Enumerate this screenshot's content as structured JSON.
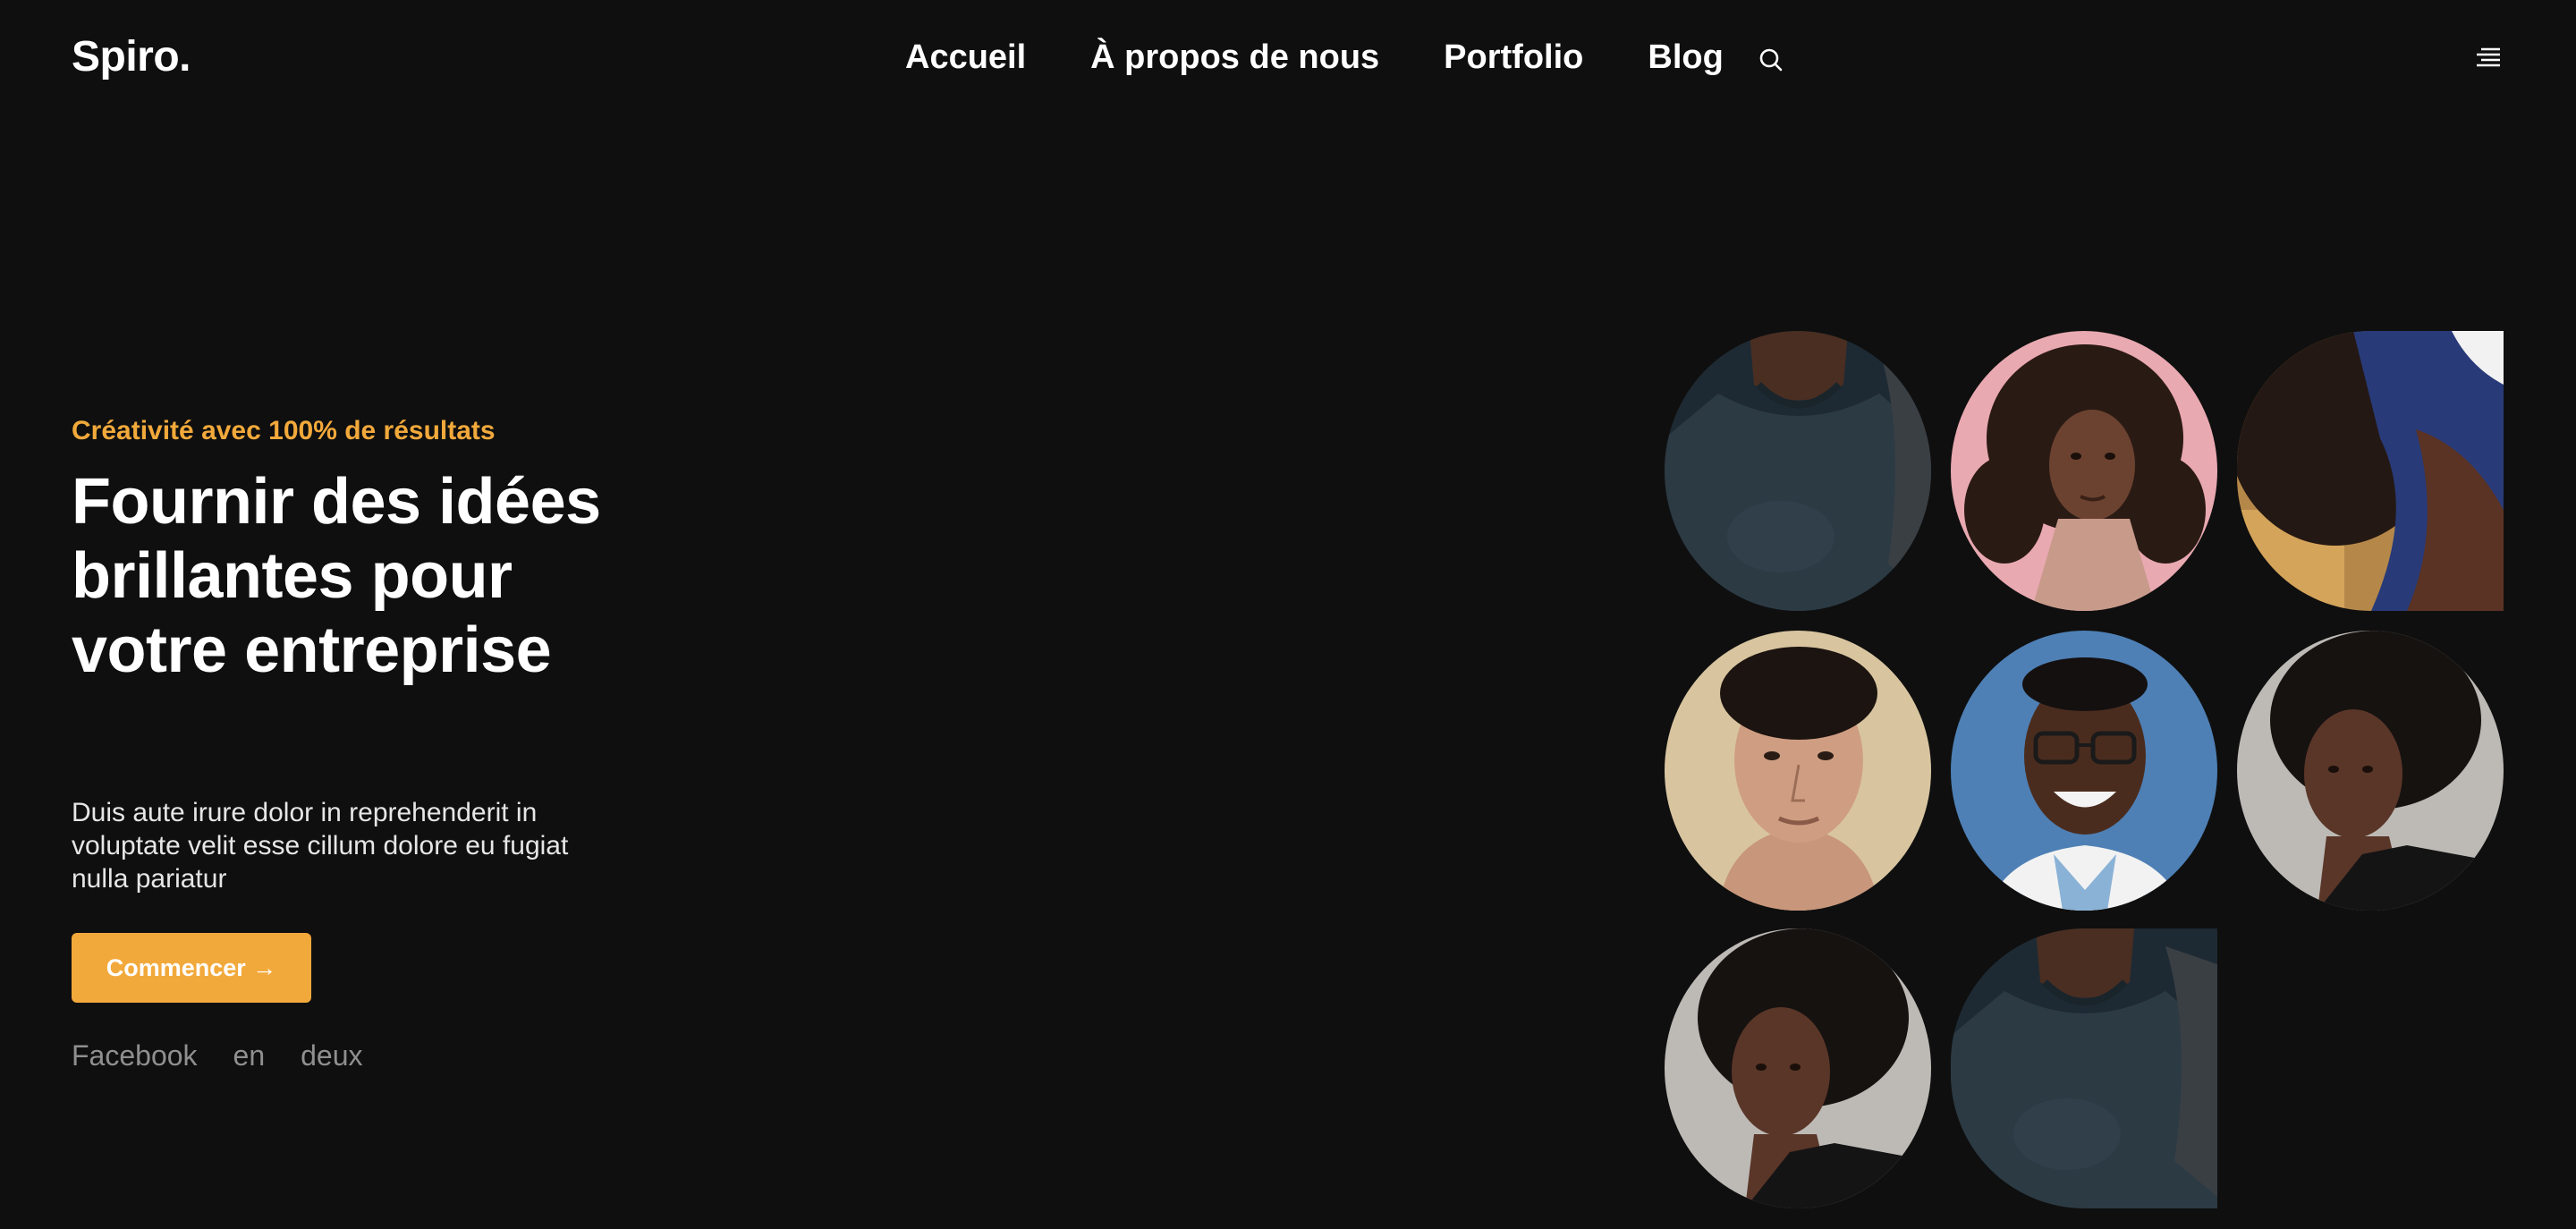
{
  "header": {
    "logo": "Spiro.",
    "nav": [
      "Accueil",
      "À propos de nous",
      "Portfolio",
      "Blog"
    ],
    "search_icon": "search-icon",
    "menu_icon": "hamburger-menu-icon"
  },
  "hero": {
    "tagline": "Créativité avec 100% de résultats",
    "title": "Fournir des idées brillantes pour votre entreprise",
    "description": "Duis aute irure dolor in reprehenderit in voluptate velit esse cillum dolore eu fugiat nulla pariatur",
    "cta_label": "Commencer →",
    "social_links": [
      "Facebook",
      "en",
      "deux"
    ]
  },
  "colors": {
    "background": "#0f0f0f",
    "accent": "#f2a93b",
    "text": "#ffffff",
    "muted": "#8f8f8f"
  }
}
